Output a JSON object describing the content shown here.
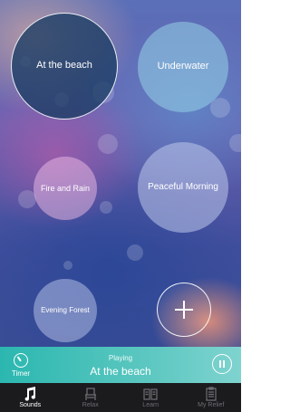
{
  "sounds": {
    "beach": "At the beach",
    "underwater": "Underwater",
    "fire_rain": "Fire and Rain",
    "peaceful_morning": "Peaceful Morning",
    "evening_forest": "Evening Forest"
  },
  "player": {
    "timer_label": "Timer",
    "status_label": "Playing",
    "now_playing": "At the beach"
  },
  "tabs": [
    {
      "label": "Sounds",
      "icon": "music-note-icon",
      "active": true
    },
    {
      "label": "Relax",
      "icon": "chair-icon",
      "active": false
    },
    {
      "label": "Learn",
      "icon": "book-icon",
      "active": false
    },
    {
      "label": "My Relief",
      "icon": "clipboard-icon",
      "active": false
    }
  ],
  "colors": {
    "player_bar": "#2bb7b0",
    "tab_bar": "#1b1b1e",
    "selected_bubble": "#193c64"
  }
}
